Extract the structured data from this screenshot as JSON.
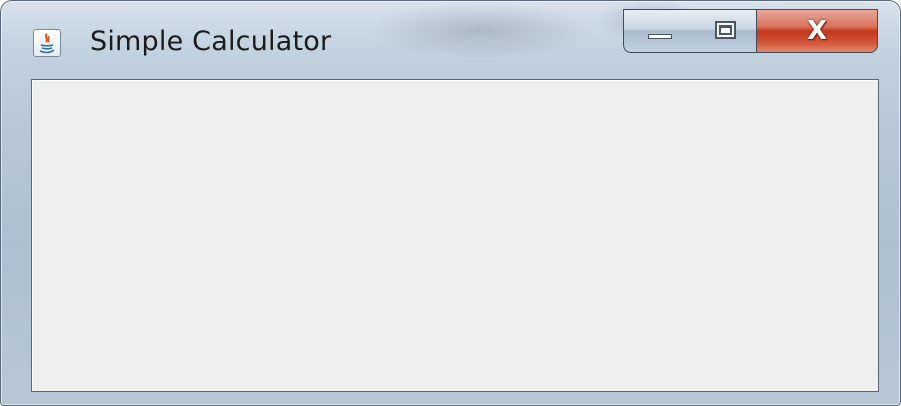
{
  "window": {
    "title": "Simple Calculator",
    "icon": "java-icon"
  },
  "title_bar_controls": {
    "minimize_icon": "minimize-icon",
    "maximize_icon": "maximize-icon",
    "close_glyph": "X"
  },
  "colors": {
    "client_background": "#efefef",
    "close_button": "#c4371c",
    "title_text": "#1b1b1b"
  }
}
